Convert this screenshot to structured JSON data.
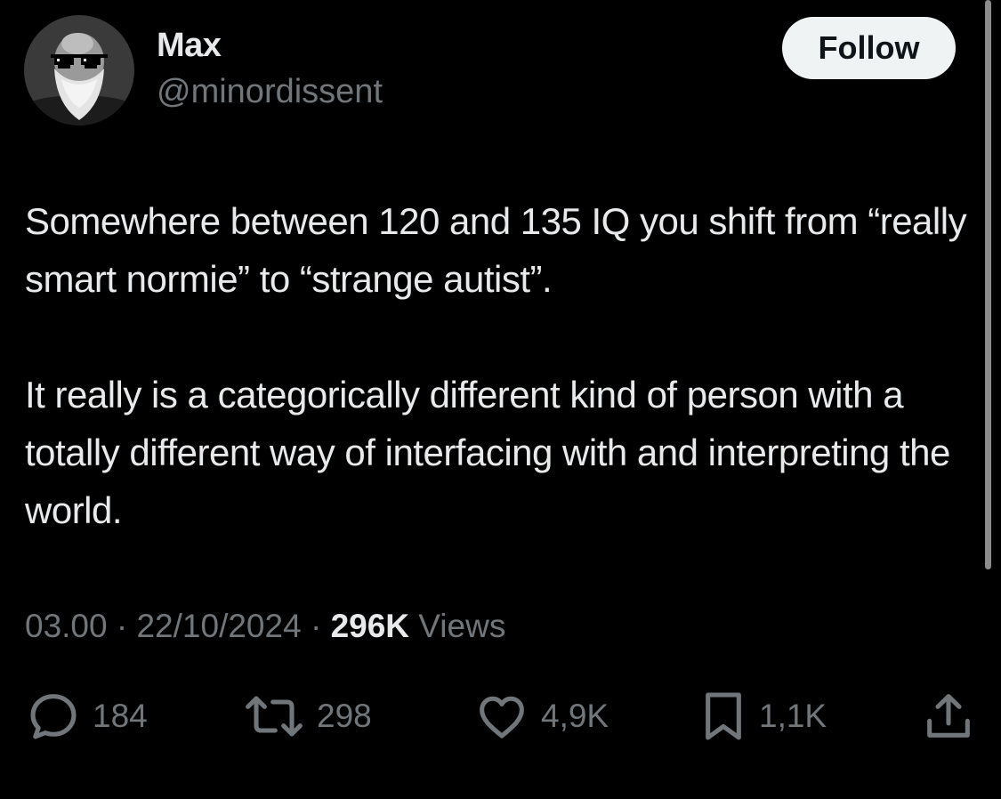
{
  "author": {
    "display_name": "Max",
    "handle": "@minordissent"
  },
  "follow_button": {
    "label": "Follow"
  },
  "tweet": {
    "paragraphs": [
      "Somewhere between 120 and 135 IQ you shift from “really smart normie” to “strange autist”.",
      "It really is a categorically different kind of person with a totally different way of interfacing with and interpreting the world."
    ]
  },
  "meta": {
    "time": "03.00",
    "separator": " · ",
    "date": "22/10/2024",
    "views_count": "296K",
    "views_label": " Views"
  },
  "actions": {
    "reply_count": "184",
    "repost_count": "298",
    "like_count": "4,9K",
    "bookmark_count": "1,1K"
  },
  "colors": {
    "background": "#000000",
    "primary_text": "#e7e9ea",
    "secondary_text": "#71767b",
    "follow_button_bg": "#eff3f4",
    "follow_button_text": "#0f1419"
  },
  "icons": [
    "reply-icon",
    "repost-icon",
    "like-icon",
    "bookmark-icon",
    "share-icon"
  ]
}
